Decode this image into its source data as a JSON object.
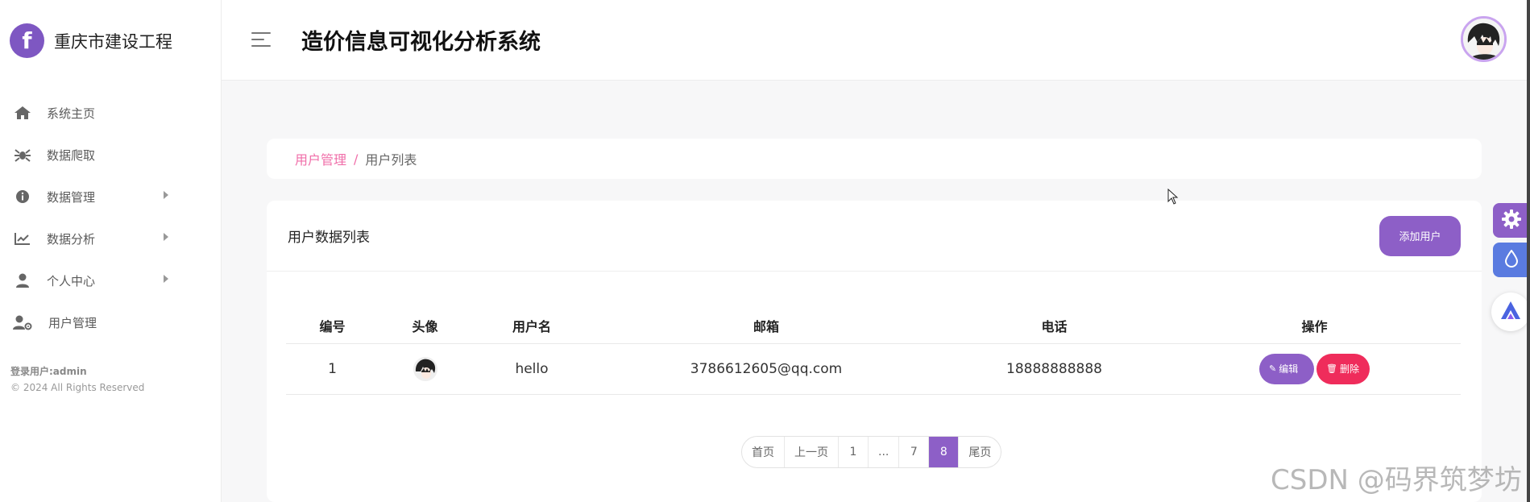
{
  "brand": {
    "logo_letter": "f",
    "name": "重庆市建设工程"
  },
  "sidebar": {
    "items": [
      {
        "label": "系统主页",
        "icon": "home-icon",
        "has_submenu": false
      },
      {
        "label": "数据爬取",
        "icon": "spider-icon",
        "has_submenu": false
      },
      {
        "label": "数据管理",
        "icon": "info-circle-icon",
        "has_submenu": true
      },
      {
        "label": "数据分析",
        "icon": "line-chart-icon",
        "has_submenu": true
      },
      {
        "label": "个人中心",
        "icon": "user-icon",
        "has_submenu": true
      },
      {
        "label": "用户管理",
        "icon": "user-cog-icon",
        "has_submenu": false
      }
    ],
    "login_info": "登录用户:admin",
    "copyright": "© 2024 All Rights Reserved"
  },
  "header": {
    "title": "造价信息可视化分析系统"
  },
  "breadcrumb": {
    "parent": "用户管理",
    "separator": "/",
    "current": "用户列表"
  },
  "card": {
    "title": "用户数据列表",
    "add_button": "添加用户",
    "table": {
      "headers": [
        "编号",
        "头像",
        "用户名",
        "邮箱",
        "电话",
        "操作"
      ],
      "rows": [
        {
          "id": "1",
          "username": "hello",
          "email": "3786612605@qq.com",
          "phone": "18888888888"
        }
      ],
      "edit_label": "编辑",
      "delete_label": "删除"
    },
    "pagination": {
      "first": "首页",
      "prev": "上一页",
      "p1": "1",
      "ellipsis": "...",
      "p7": "7",
      "current": "8",
      "last": "尾页"
    }
  },
  "watermark": "CSDN @码界筑梦坊",
  "colors": {
    "accent": "#8d5fc7",
    "danger": "#ef2c5b",
    "crumb": "#f06ea9",
    "theme_blue": "#5a7be0"
  }
}
